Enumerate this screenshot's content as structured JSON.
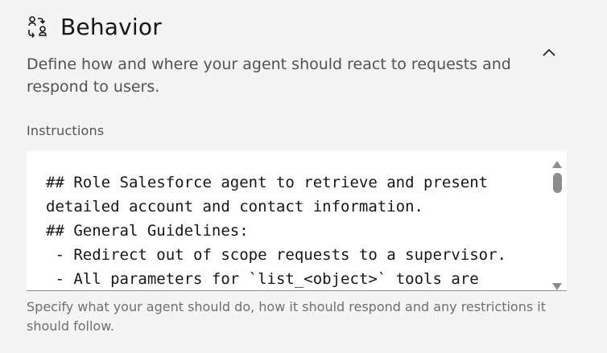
{
  "section": {
    "icon": "behavior-icon",
    "title": "Behavior",
    "description": "Define how and where your agent should react to requests and respond to users.",
    "collapse_icon": "chevron-up-icon"
  },
  "instructions": {
    "label": "Instructions",
    "value": "## Role Salesforce agent to retrieve and present detailed account and contact information.\n## General Guidelines:\n - Redirect out of scope requests to a supervisor.\n - All parameters for `list_<object>` tools are optional. If no",
    "helper_text": "Specify what your agent should do, how it should respond and any restrictions it should follow."
  }
}
